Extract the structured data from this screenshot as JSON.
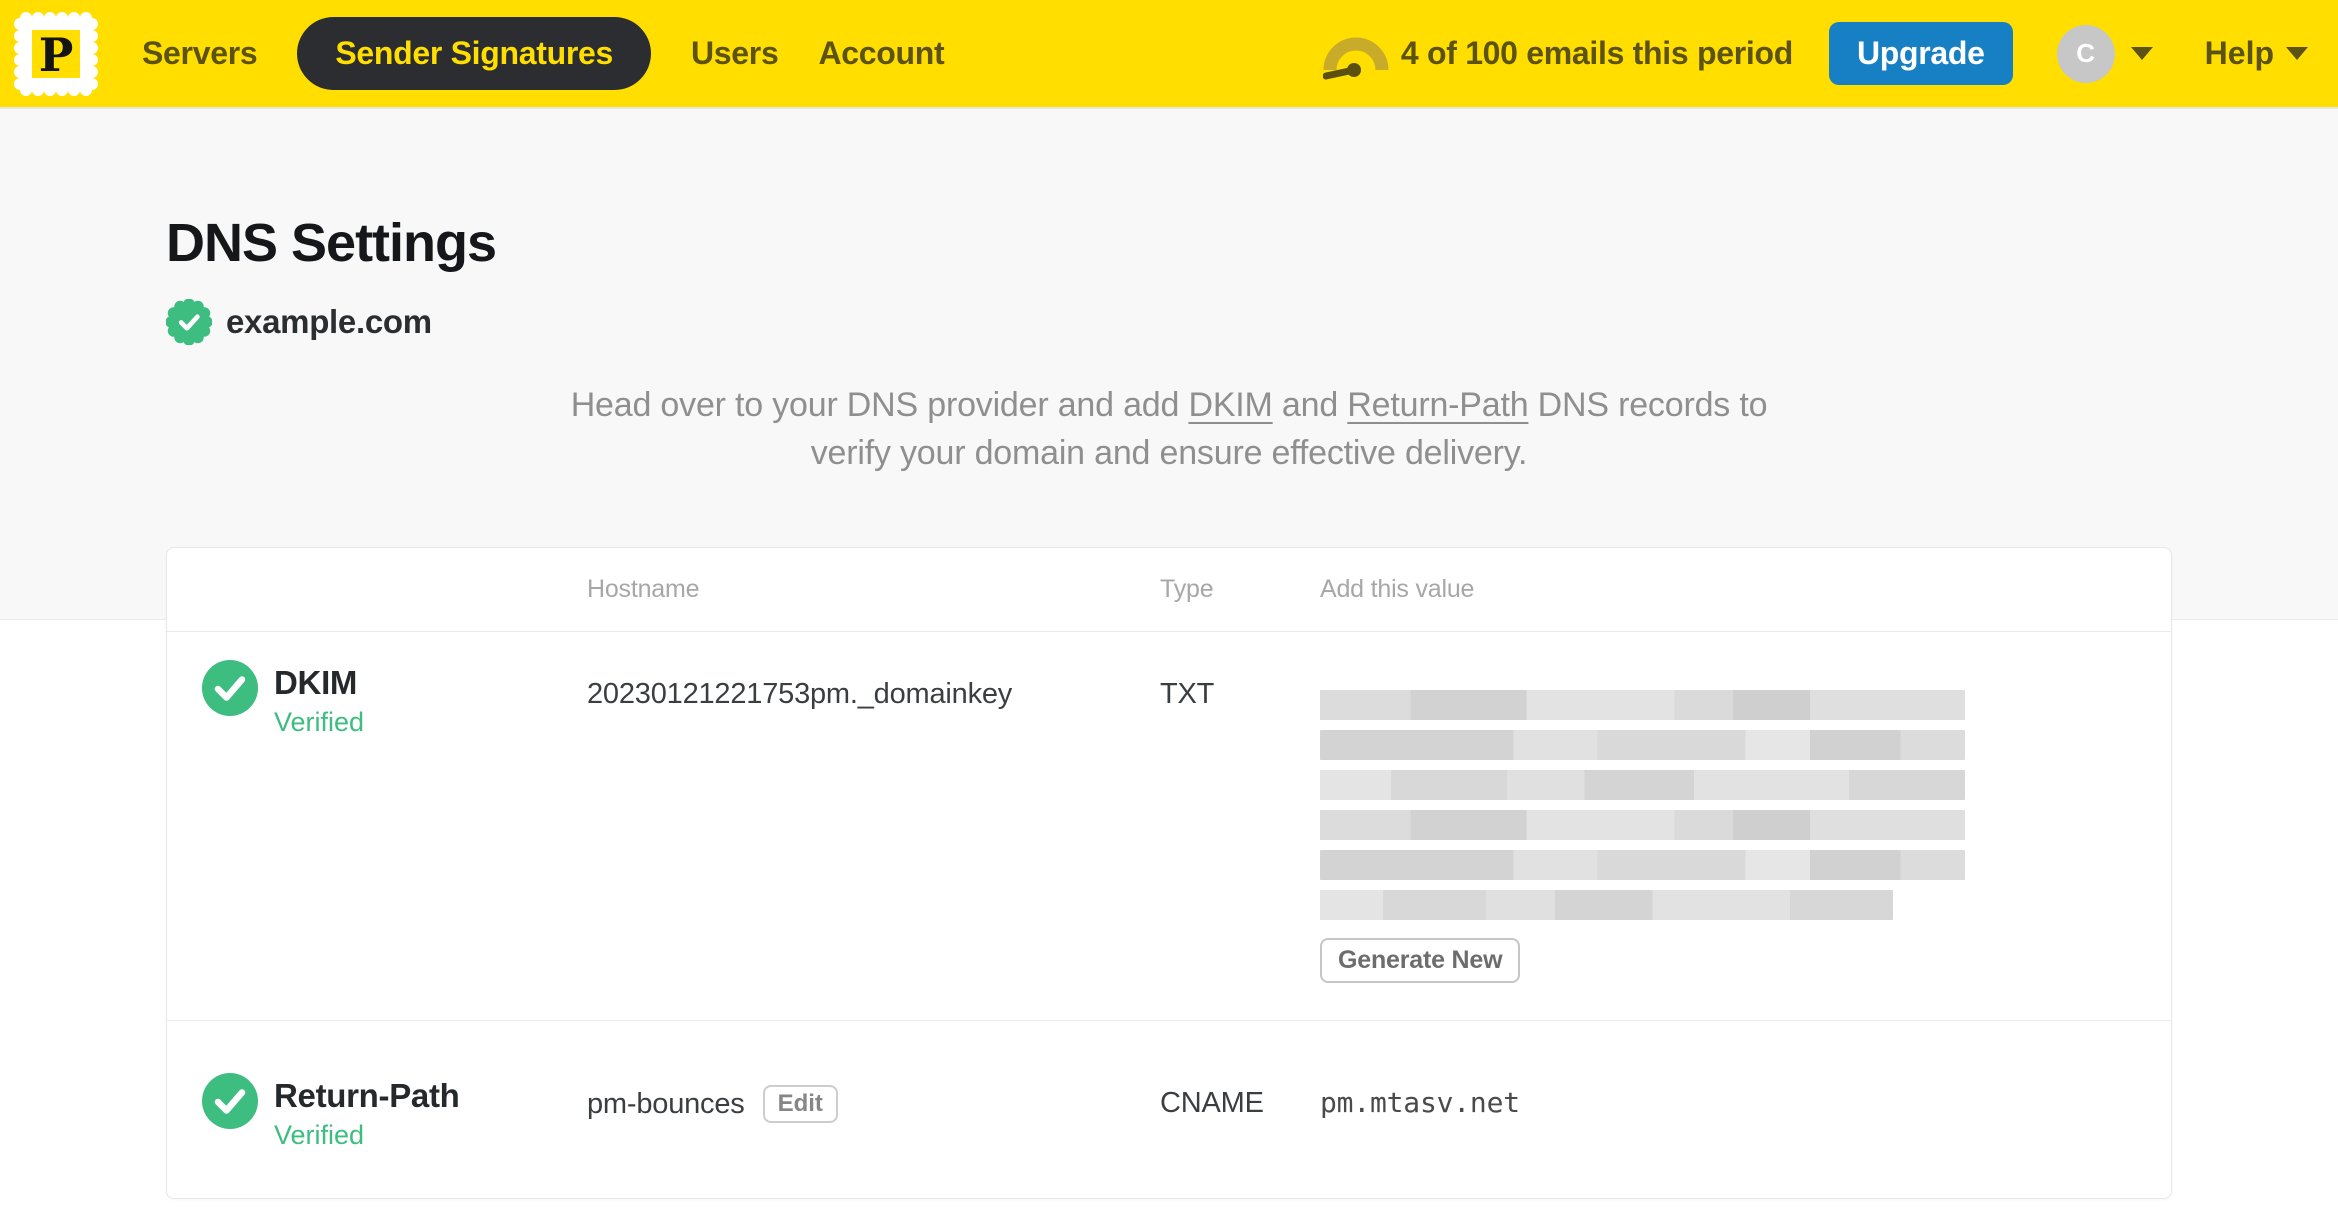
{
  "nav": {
    "logo_letter": "P",
    "items": [
      {
        "label": "Servers",
        "active": false
      },
      {
        "label": "Sender Signatures",
        "active": true
      },
      {
        "label": "Users",
        "active": false
      },
      {
        "label": "Account",
        "active": false
      }
    ],
    "usage_text": "4 of 100 emails this period",
    "upgrade_label": "Upgrade",
    "avatar_initial": "C",
    "help_label": "Help"
  },
  "page": {
    "title": "DNS Settings",
    "domain": "example.com",
    "domain_status": "verified",
    "instructions": {
      "lead": "Head over to your DNS provider and add ",
      "link_dkim": "DKIM",
      "middle": " and ",
      "link_return_path": "Return-Path",
      "tail": " DNS records to",
      "line2": "verify your domain and ensure effective delivery."
    }
  },
  "table": {
    "headers": {
      "hostname": "Hostname",
      "type": "Type",
      "value": "Add this value"
    },
    "rows": [
      {
        "name": "DKIM",
        "status": "Verified",
        "hostname": "20230121221753pm._domainkey",
        "type": "TXT",
        "value_redacted": true,
        "redacted_line_widths": [
          645,
          645,
          645,
          645,
          645,
          573
        ],
        "action_label": "Generate New"
      },
      {
        "name": "Return-Path",
        "status": "Verified",
        "hostname": "pm-bounces",
        "edit_label": "Edit",
        "type": "CNAME",
        "value": "pm.mtasv.net"
      }
    ]
  },
  "colors": {
    "brand_yellow": "#ffde00",
    "nav_text": "#5b5214",
    "active_pill_bg": "#2b2d31",
    "upgrade_blue": "#1780c4",
    "success_green": "#3ebd80",
    "muted_text": "#8f8f8f",
    "header_text": "#a7a7a7",
    "body_text": "#3b3e40",
    "page_bg_top": "#f8f8f8",
    "card_border": "#e7e7e7",
    "avatar_gray": "#c7c7c7"
  }
}
